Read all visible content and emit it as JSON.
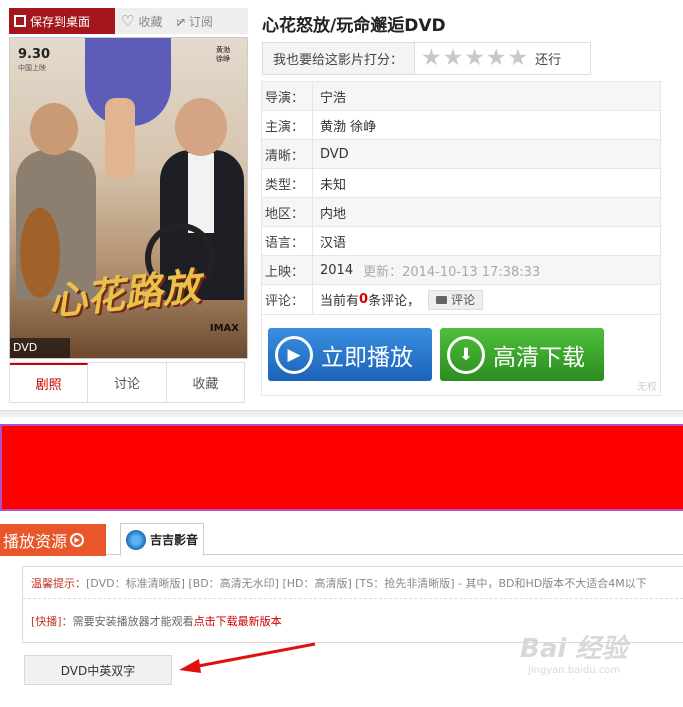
{
  "toolbar": {
    "save_label": "保存到桌面",
    "favorite_label": "收藏",
    "subscribe_label": "订阅"
  },
  "poster": {
    "date": "9.30",
    "sub": "中国上映",
    "title": "心花路放",
    "imax": "IMAX",
    "tag": "DVD"
  },
  "left_tabs": [
    "剧照",
    "讨论",
    "收藏"
  ],
  "movie": {
    "title": "心花怒放/玩命邂逅DVD"
  },
  "rating": {
    "label": "我也要给这影片打分：",
    "stars": 5,
    "text": "还行"
  },
  "info": {
    "director_k": "导演：",
    "director_v": "宁浩",
    "cast_k": "主演：",
    "cast_v": "黄渤 徐峥",
    "quality_k": "清晰：",
    "quality_v": "DVD",
    "type_k": "类型：",
    "type_v": "未知",
    "region_k": "地区：",
    "region_v": "内地",
    "language_k": "语言：",
    "language_v": "汉语",
    "release_k": "上映：",
    "release_v": "2014",
    "updated": "更新：2014-10-13 17:38:33",
    "comment_k": "评论：",
    "comment_pre": "当前有",
    "comment_count": "0",
    "comment_post": "条评论，",
    "comment_btn": "评论"
  },
  "buttons": {
    "play": "立即播放",
    "download": "高清下载",
    "nopower": "无权"
  },
  "resources": {
    "label": "播放资源",
    "tab": "吉吉影音",
    "tip_label": "温馨提示：",
    "tip_text": "[DVD：标准清晰版] [BD：高清无水印] [HD：高清版] [TS：抢先非清晰版] - 其中，BD和HD版本不大适合4M以下",
    "kb_label": "[快播]：",
    "kb_text": "需要安装播放器才能观看",
    "kb_link": "点击下载最新版本",
    "episode": "DVD中英双字"
  },
  "watermark": {
    "main": "Bai 经验",
    "sub": "jingyan.baidu.com"
  }
}
